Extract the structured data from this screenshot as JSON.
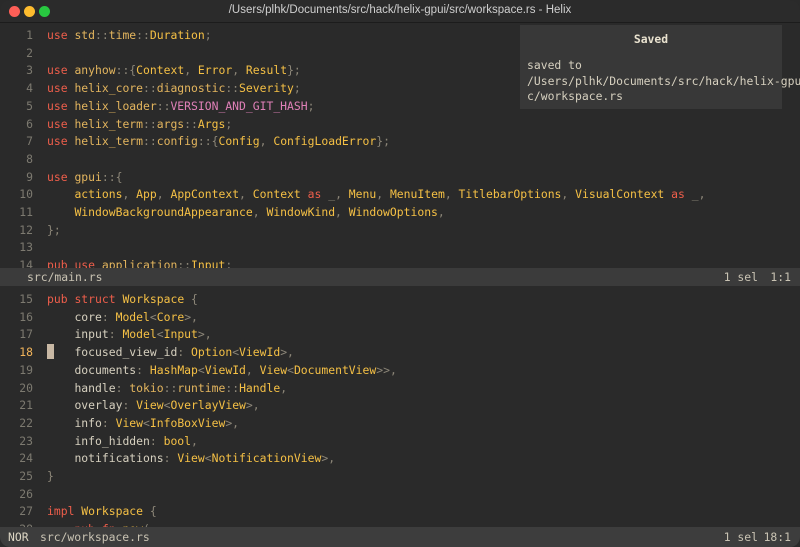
{
  "window": {
    "title": "/Users/plhk/Documents/src/hack/helix-gpui/src/workspace.rs - Helix"
  },
  "top_pane": {
    "lines": [
      {
        "n": "1",
        "tokens": [
          [
            "kw",
            "use"
          ],
          [
            "id",
            " "
          ],
          [
            "mod",
            "std"
          ],
          [
            "sep",
            "::"
          ],
          [
            "mod",
            "time"
          ],
          [
            "sep",
            "::"
          ],
          [
            "ty",
            "Duration"
          ],
          [
            "sep",
            ";"
          ]
        ]
      },
      {
        "n": "2",
        "tokens": []
      },
      {
        "n": "3",
        "tokens": [
          [
            "kw",
            "use"
          ],
          [
            "id",
            " "
          ],
          [
            "mod",
            "anyhow"
          ],
          [
            "sep",
            "::{"
          ],
          [
            "ty",
            "Context"
          ],
          [
            "sep",
            ", "
          ],
          [
            "ty",
            "Error"
          ],
          [
            "sep",
            ", "
          ],
          [
            "ty",
            "Result"
          ],
          [
            "sep",
            "};"
          ]
        ]
      },
      {
        "n": "4",
        "tokens": [
          [
            "kw",
            "use"
          ],
          [
            "id",
            " "
          ],
          [
            "mod",
            "helix_core"
          ],
          [
            "sep",
            "::"
          ],
          [
            "mod",
            "diagnostic"
          ],
          [
            "sep",
            "::"
          ],
          [
            "ty",
            "Severity"
          ],
          [
            "sep",
            ";"
          ]
        ]
      },
      {
        "n": "5",
        "tokens": [
          [
            "kw",
            "use"
          ],
          [
            "id",
            " "
          ],
          [
            "mod",
            "helix_loader"
          ],
          [
            "sep",
            "::"
          ],
          [
            "cst",
            "VERSION_AND_GIT_HASH"
          ],
          [
            "sep",
            ";"
          ]
        ]
      },
      {
        "n": "6",
        "tokens": [
          [
            "kw",
            "use"
          ],
          [
            "id",
            " "
          ],
          [
            "mod",
            "helix_term"
          ],
          [
            "sep",
            "::"
          ],
          [
            "mod",
            "args"
          ],
          [
            "sep",
            "::"
          ],
          [
            "ty",
            "Args"
          ],
          [
            "sep",
            ";"
          ]
        ]
      },
      {
        "n": "7",
        "tokens": [
          [
            "kw",
            "use"
          ],
          [
            "id",
            " "
          ],
          [
            "mod",
            "helix_term"
          ],
          [
            "sep",
            "::"
          ],
          [
            "mod",
            "config"
          ],
          [
            "sep",
            "::{"
          ],
          [
            "ty",
            "Config"
          ],
          [
            "sep",
            ", "
          ],
          [
            "ty",
            "ConfigLoadError"
          ],
          [
            "sep",
            "};"
          ]
        ]
      },
      {
        "n": "8",
        "tokens": []
      },
      {
        "n": "9",
        "tokens": [
          [
            "kw",
            "use"
          ],
          [
            "id",
            " "
          ],
          [
            "mod",
            "gpui"
          ],
          [
            "sep",
            "::{"
          ]
        ]
      },
      {
        "n": "10",
        "tokens": [
          [
            "id",
            "    "
          ],
          [
            "ty",
            "actions"
          ],
          [
            "sep",
            ", "
          ],
          [
            "ty",
            "App"
          ],
          [
            "sep",
            ", "
          ],
          [
            "ty",
            "AppContext"
          ],
          [
            "sep",
            ", "
          ],
          [
            "ty",
            "Context"
          ],
          [
            "id",
            " "
          ],
          [
            "kw",
            "as"
          ],
          [
            "id",
            " "
          ],
          [
            "sep",
            "_, "
          ],
          [
            "ty",
            "Menu"
          ],
          [
            "sep",
            ", "
          ],
          [
            "ty",
            "MenuItem"
          ],
          [
            "sep",
            ", "
          ],
          [
            "ty",
            "TitlebarOptions"
          ],
          [
            "sep",
            ", "
          ],
          [
            "ty",
            "VisualContext"
          ],
          [
            "id",
            " "
          ],
          [
            "kw",
            "as"
          ],
          [
            "id",
            " "
          ],
          [
            "sep",
            "_,"
          ]
        ]
      },
      {
        "n": "11",
        "tokens": [
          [
            "id",
            "    "
          ],
          [
            "ty",
            "WindowBackgroundAppearance"
          ],
          [
            "sep",
            ", "
          ],
          [
            "ty",
            "WindowKind"
          ],
          [
            "sep",
            ", "
          ],
          [
            "ty",
            "WindowOptions"
          ],
          [
            "sep",
            ","
          ]
        ]
      },
      {
        "n": "12",
        "tokens": [
          [
            "sep",
            "};"
          ]
        ]
      },
      {
        "n": "13",
        "tokens": []
      },
      {
        "n": "14",
        "tokens": [
          [
            "kw",
            "pub"
          ],
          [
            "id",
            " "
          ],
          [
            "kw",
            "use"
          ],
          [
            "id",
            " "
          ],
          [
            "mod",
            "application"
          ],
          [
            "sep",
            "::"
          ],
          [
            "ty",
            "Input"
          ],
          [
            "sep",
            ";"
          ]
        ]
      }
    ]
  },
  "top_status": {
    "file": "src/main.rs",
    "selections": "1 sel",
    "position": "1:1"
  },
  "bottom_pane": {
    "current_line": "18",
    "lines": [
      {
        "n": "15",
        "tokens": [
          [
            "kw",
            "pub"
          ],
          [
            "id",
            " "
          ],
          [
            "kw",
            "struct"
          ],
          [
            "id",
            " "
          ],
          [
            "ty",
            "Workspace"
          ],
          [
            "id",
            " "
          ],
          [
            "sep",
            "{"
          ]
        ]
      },
      {
        "n": "16",
        "tokens": [
          [
            "id",
            "    "
          ],
          [
            "fld",
            "core"
          ],
          [
            "sep",
            ": "
          ],
          [
            "ty",
            "Model"
          ],
          [
            "sep",
            "<"
          ],
          [
            "ty",
            "Core"
          ],
          [
            "sep",
            ">,"
          ]
        ]
      },
      {
        "n": "17",
        "tokens": [
          [
            "id",
            "    "
          ],
          [
            "fld",
            "input"
          ],
          [
            "sep",
            ": "
          ],
          [
            "ty",
            "Model"
          ],
          [
            "sep",
            "<"
          ],
          [
            "ty",
            "Input"
          ],
          [
            "sep",
            ">,"
          ]
        ]
      },
      {
        "n": "18",
        "tokens": [
          [
            "id",
            "    "
          ],
          [
            "fld",
            "focused_view_id"
          ],
          [
            "sep",
            ": "
          ],
          [
            "ty",
            "Option"
          ],
          [
            "sep",
            "<"
          ],
          [
            "ty",
            "ViewId"
          ],
          [
            "sep",
            ">,"
          ]
        ]
      },
      {
        "n": "19",
        "tokens": [
          [
            "id",
            "    "
          ],
          [
            "fld",
            "documents"
          ],
          [
            "sep",
            ": "
          ],
          [
            "ty",
            "HashMap"
          ],
          [
            "sep",
            "<"
          ],
          [
            "ty",
            "ViewId"
          ],
          [
            "sep",
            ", "
          ],
          [
            "ty",
            "View"
          ],
          [
            "sep",
            "<"
          ],
          [
            "ty",
            "DocumentView"
          ],
          [
            "sep",
            ">>,"
          ]
        ]
      },
      {
        "n": "20",
        "tokens": [
          [
            "id",
            "    "
          ],
          [
            "fld",
            "handle"
          ],
          [
            "sep",
            ": "
          ],
          [
            "mod",
            "tokio"
          ],
          [
            "sep",
            "::"
          ],
          [
            "mod",
            "runtime"
          ],
          [
            "sep",
            "::"
          ],
          [
            "ty",
            "Handle"
          ],
          [
            "sep",
            ","
          ]
        ]
      },
      {
        "n": "21",
        "tokens": [
          [
            "id",
            "    "
          ],
          [
            "fld",
            "overlay"
          ],
          [
            "sep",
            ": "
          ],
          [
            "ty",
            "View"
          ],
          [
            "sep",
            "<"
          ],
          [
            "ty",
            "OverlayView"
          ],
          [
            "sep",
            ">,"
          ]
        ]
      },
      {
        "n": "22",
        "tokens": [
          [
            "id",
            "    "
          ],
          [
            "fld",
            "info"
          ],
          [
            "sep",
            ": "
          ],
          [
            "ty",
            "View"
          ],
          [
            "sep",
            "<"
          ],
          [
            "ty",
            "InfoBoxView"
          ],
          [
            "sep",
            ">,"
          ]
        ]
      },
      {
        "n": "23",
        "tokens": [
          [
            "id",
            "    "
          ],
          [
            "fld",
            "info_hidden"
          ],
          [
            "sep",
            ": "
          ],
          [
            "ty",
            "bool"
          ],
          [
            "sep",
            ","
          ]
        ]
      },
      {
        "n": "24",
        "tokens": [
          [
            "id",
            "    "
          ],
          [
            "fld",
            "notifications"
          ],
          [
            "sep",
            ": "
          ],
          [
            "ty",
            "View"
          ],
          [
            "sep",
            "<"
          ],
          [
            "ty",
            "NotificationView"
          ],
          [
            "sep",
            ">,"
          ]
        ]
      },
      {
        "n": "25",
        "tokens": [
          [
            "sep",
            "}"
          ]
        ]
      },
      {
        "n": "26",
        "tokens": []
      },
      {
        "n": "27",
        "tokens": [
          [
            "kw",
            "impl"
          ],
          [
            "id",
            " "
          ],
          [
            "ty",
            "Workspace"
          ],
          [
            "id",
            " "
          ],
          [
            "sep",
            "{"
          ]
        ]
      },
      {
        "n": "28",
        "tokens": [
          [
            "id",
            "    "
          ],
          [
            "kw",
            "pub"
          ],
          [
            "id",
            " "
          ],
          [
            "kw",
            "fn"
          ],
          [
            "id",
            " "
          ],
          [
            "ty",
            "new"
          ],
          [
            "sep",
            "("
          ]
        ]
      }
    ]
  },
  "bottom_status": {
    "mode": "NOR",
    "file": "src/workspace.rs",
    "selections": "1 sel",
    "position": "18:1"
  },
  "popup": {
    "title": "Saved",
    "message": "saved to\n/Users/plhk/Documents/src/hack/helix-gpui/sr\nc/workspace.rs"
  }
}
